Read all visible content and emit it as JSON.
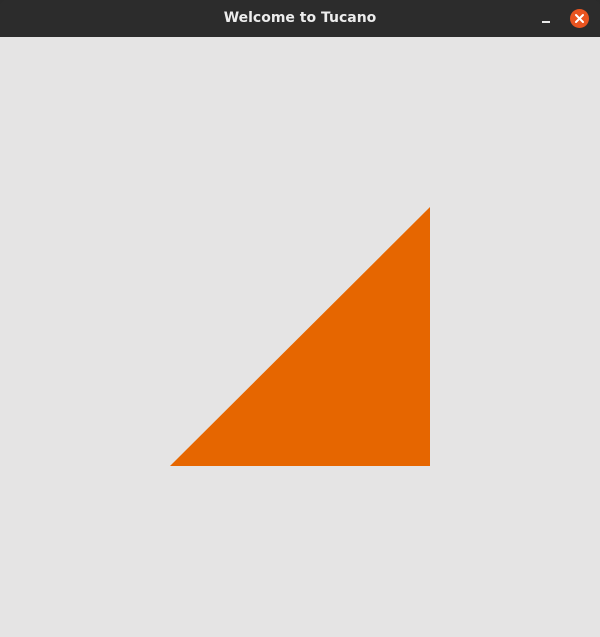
{
  "window": {
    "title": "Welcome to Tucano",
    "minimize_icon": "minimize-icon",
    "close_icon": "close-icon"
  },
  "colors": {
    "titlebar": "#2c2c2c",
    "canvas_background": "#e5e4e4",
    "close_button": "#e95420",
    "triangle_fill": "#e66600"
  },
  "scene": {
    "shape": "right-triangle",
    "fill": "#e66600"
  }
}
